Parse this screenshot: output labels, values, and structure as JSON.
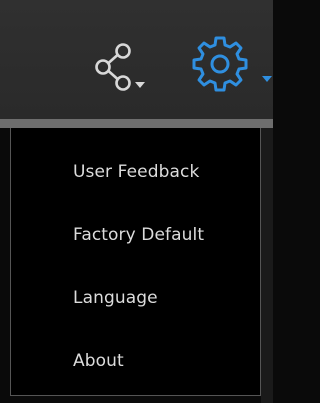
{
  "toolbar": {
    "share": {
      "icon": "share-icon",
      "has_dropdown": true
    },
    "settings": {
      "icon": "gear-icon",
      "has_dropdown": true,
      "accent": "#2f8fe0"
    }
  },
  "menu": {
    "items": [
      {
        "label": "User Feedback"
      },
      {
        "label": "Factory Default"
      },
      {
        "label": "Language"
      },
      {
        "label": "About"
      }
    ]
  },
  "colors": {
    "toolbar_bg": "#2d2d2d",
    "menu_bg": "#000000",
    "menu_text": "#dcdcdc",
    "accent": "#2f8fe0"
  }
}
